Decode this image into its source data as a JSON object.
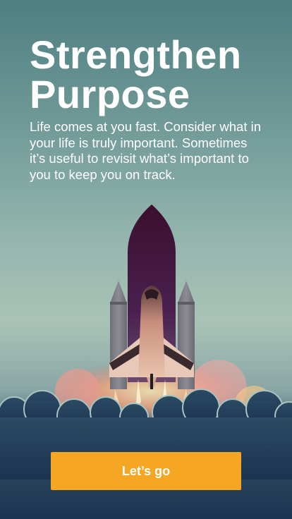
{
  "onboarding": {
    "title_line1": "Strengthen",
    "title_line2": "Purpose",
    "body": "Life comes at you fast. Consider what in your life is truly important. Sometimes it’s useful to revisit what’s important to you to keep you on track.",
    "illustration_icon": "space-shuttle-launch-illustration",
    "cta_label": "Let’s go"
  },
  "colors": {
    "cta_background": "#f5a623",
    "text": "#ffffff"
  }
}
